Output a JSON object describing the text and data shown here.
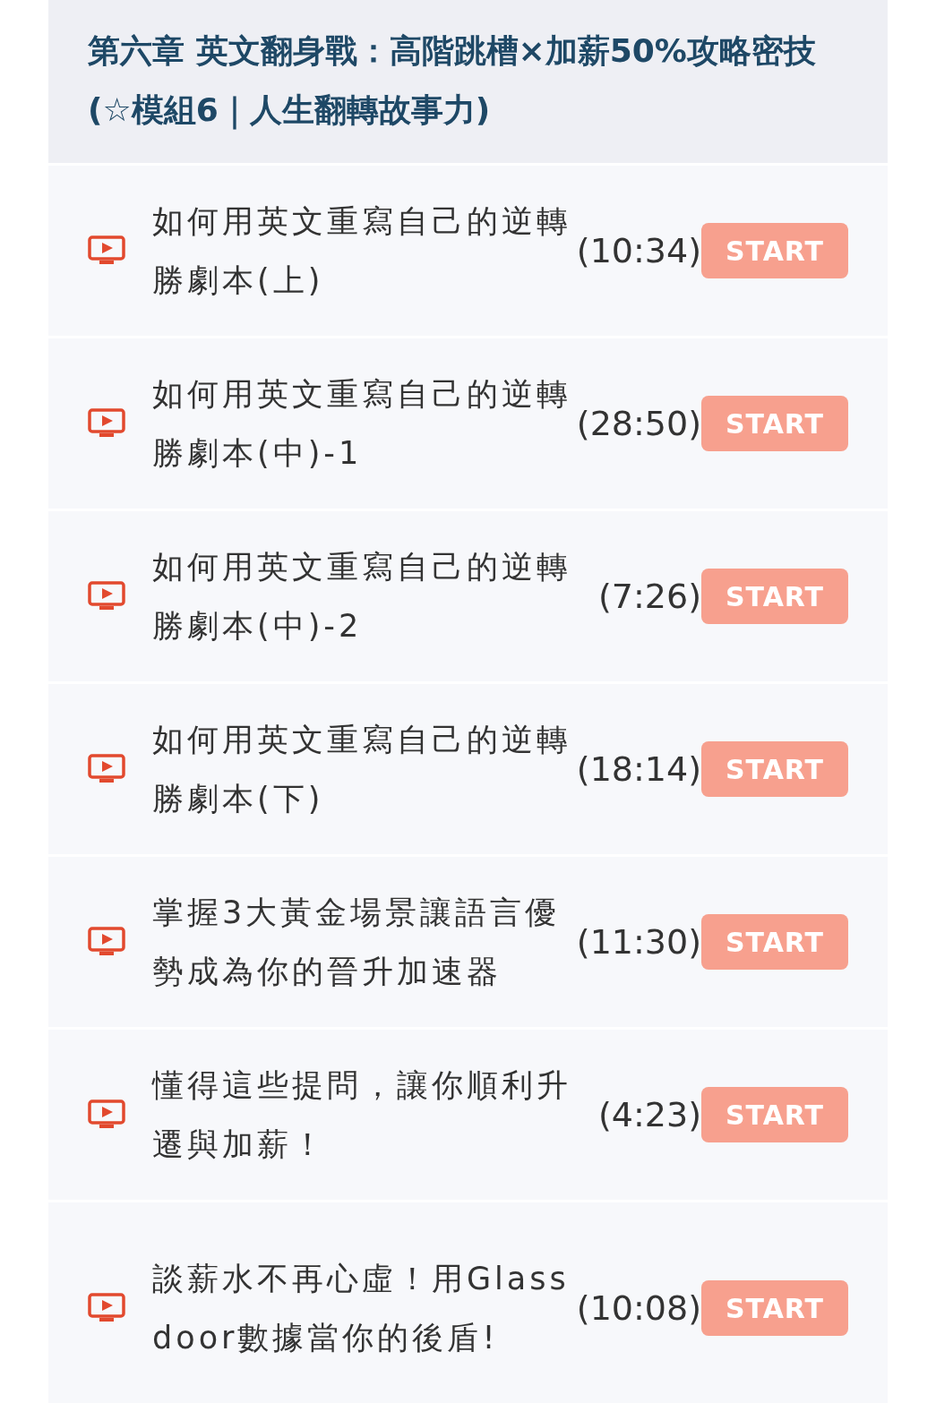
{
  "chapter": {
    "title": "第六章 英文翻身戰：高階跳槽×加薪50%攻略密技 (☆模組6｜人生翻轉故事力)"
  },
  "lessons": [
    {
      "title": "如何用英文重寫自己的逆轉勝劇本(上)",
      "duration": "(10:34)",
      "button": "START"
    },
    {
      "title": "如何用英文重寫自己的逆轉勝劇本(中)-1",
      "duration": "(28:50)",
      "button": "START"
    },
    {
      "title": "如何用英文重寫自己的逆轉勝劇本(中)-2",
      "duration": "(7:26)",
      "button": "START"
    },
    {
      "title": "如何用英文重寫自己的逆轉勝劇本(下)",
      "duration": "(18:14)",
      "button": "START"
    },
    {
      "title": "掌握3大黃金場景讓語言優勢成為你的晉升加速器",
      "duration": "(11:30)",
      "button": "START"
    },
    {
      "title": "懂得這些提問，讓你順利升遷與加薪！",
      "duration": "(4:23)",
      "button": "START"
    },
    {
      "title": "談薪水不再心虛！用Glassdoor數據當你的後盾!",
      "duration": "(10:08)",
      "button": "START"
    }
  ]
}
